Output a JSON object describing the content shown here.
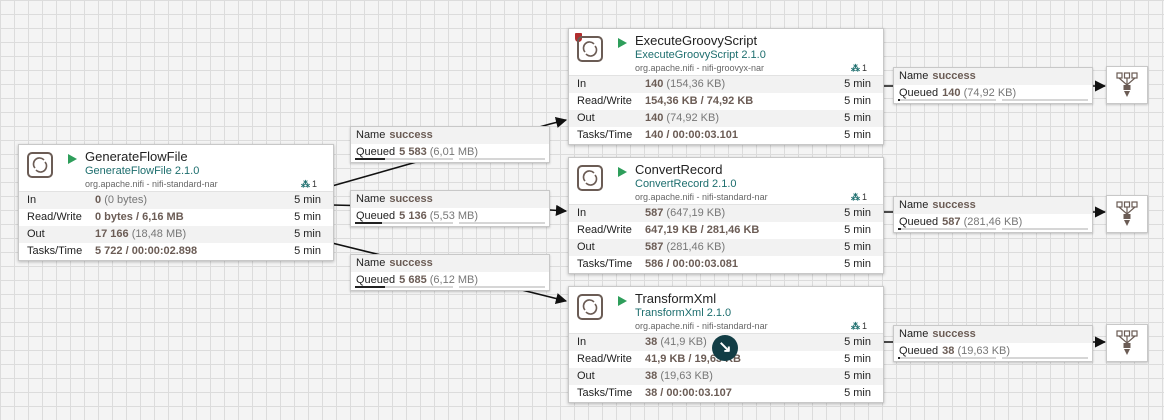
{
  "processors": {
    "generate": {
      "name": "GenerateFlowFile",
      "type": "GenerateFlowFile 2.1.0",
      "bundle": "org.apache.nifi - nifi-standard-nar",
      "cluster_count": "1",
      "in_label": "In",
      "in_value": "0",
      "in_sub": "(0 bytes)",
      "in_time": "5 min",
      "rw_label": "Read/Write",
      "rw_value": "0 bytes / 6,16 MB",
      "rw_time": "5 min",
      "out_label": "Out",
      "out_value": "17 166",
      "out_sub": "(18,48 MB)",
      "out_time": "5 min",
      "tasks_label": "Tasks/Time",
      "tasks_value": "5 722 / 00:00:02.898",
      "tasks_time": "5 min"
    },
    "groovy": {
      "name": "ExecuteGroovyScript",
      "type": "ExecuteGroovyScript 2.1.0",
      "bundle": "org.apache.nifi - nifi-groovyx-nar",
      "cluster_count": "1",
      "in_label": "In",
      "in_value": "140",
      "in_sub": "(154,36 KB)",
      "in_time": "5 min",
      "rw_label": "Read/Write",
      "rw_value": "154,36 KB / 74,92 KB",
      "rw_time": "5 min",
      "out_label": "Out",
      "out_value": "140",
      "out_sub": "(74,92 KB)",
      "out_time": "5 min",
      "tasks_label": "Tasks/Time",
      "tasks_value": "140 / 00:00:03.101",
      "tasks_time": "5 min"
    },
    "convert": {
      "name": "ConvertRecord",
      "type": "ConvertRecord 2.1.0",
      "bundle": "org.apache.nifi - nifi-standard-nar",
      "cluster_count": "1",
      "in_label": "In",
      "in_value": "587",
      "in_sub": "(647,19 KB)",
      "in_time": "5 min",
      "rw_label": "Read/Write",
      "rw_value": "647,19 KB / 281,46 KB",
      "rw_time": "5 min",
      "out_label": "Out",
      "out_value": "587",
      "out_sub": "(281,46 KB)",
      "out_time": "5 min",
      "tasks_label": "Tasks/Time",
      "tasks_value": "586 / 00:00:03.081",
      "tasks_time": "5 min"
    },
    "transform": {
      "name": "TransformXml",
      "type": "TransformXml 2.1.0",
      "bundle": "org.apache.nifi - nifi-standard-nar",
      "cluster_count": "1",
      "in_label": "In",
      "in_value": "38",
      "in_sub": "(41,9 KB)",
      "in_time": "5 min",
      "rw_label": "Read/Write",
      "rw_value": "41,9 KB / 19,63 KB",
      "rw_time": "5 min",
      "out_label": "Out",
      "out_value": "38",
      "out_sub": "(19,63 KB)",
      "out_time": "5 min",
      "tasks_label": "Tasks/Time",
      "tasks_value": "38 / 00:00:03.107",
      "tasks_time": "5 min"
    }
  },
  "connections": {
    "c1": {
      "name_label": "Name",
      "name": "success",
      "queued_label": "Queued",
      "count": "5 583",
      "size": "(6,01 MB)",
      "fill": 0.31
    },
    "c2": {
      "name_label": "Name",
      "name": "success",
      "queued_label": "Queued",
      "count": "5 136",
      "size": "(5,53 MB)",
      "fill": 0.28
    },
    "c3": {
      "name_label": "Name",
      "name": "success",
      "queued_label": "Queued",
      "count": "5 685",
      "size": "(6,12 MB)",
      "fill": 0.31
    },
    "c4": {
      "name_label": "Name",
      "name": "success",
      "queued_label": "Queued",
      "count": "140",
      "size": "(74,92 KB)",
      "fill": 0.02
    },
    "c5": {
      "name_label": "Name",
      "name": "success",
      "queued_label": "Queued",
      "count": "587",
      "size": "(281,46 KB)",
      "fill": 0.03
    },
    "c6": {
      "name_label": "Name",
      "name": "success",
      "queued_label": "Queued",
      "count": "38",
      "size": "(19,63 KB)",
      "fill": 0.01
    }
  },
  "icons": {
    "processor": "processor-icon",
    "run": "running-play-icon",
    "cluster": "cluster-nodes-icon",
    "restricted": "restricted-shield-icon",
    "funnel": "funnel-icon",
    "bend": "connection-bend-point-icon"
  },
  "colors": {
    "running": "#2e9e5b",
    "type": "#1d6e6e",
    "value": "#6b5c55",
    "restricted": "#b22e2e"
  }
}
